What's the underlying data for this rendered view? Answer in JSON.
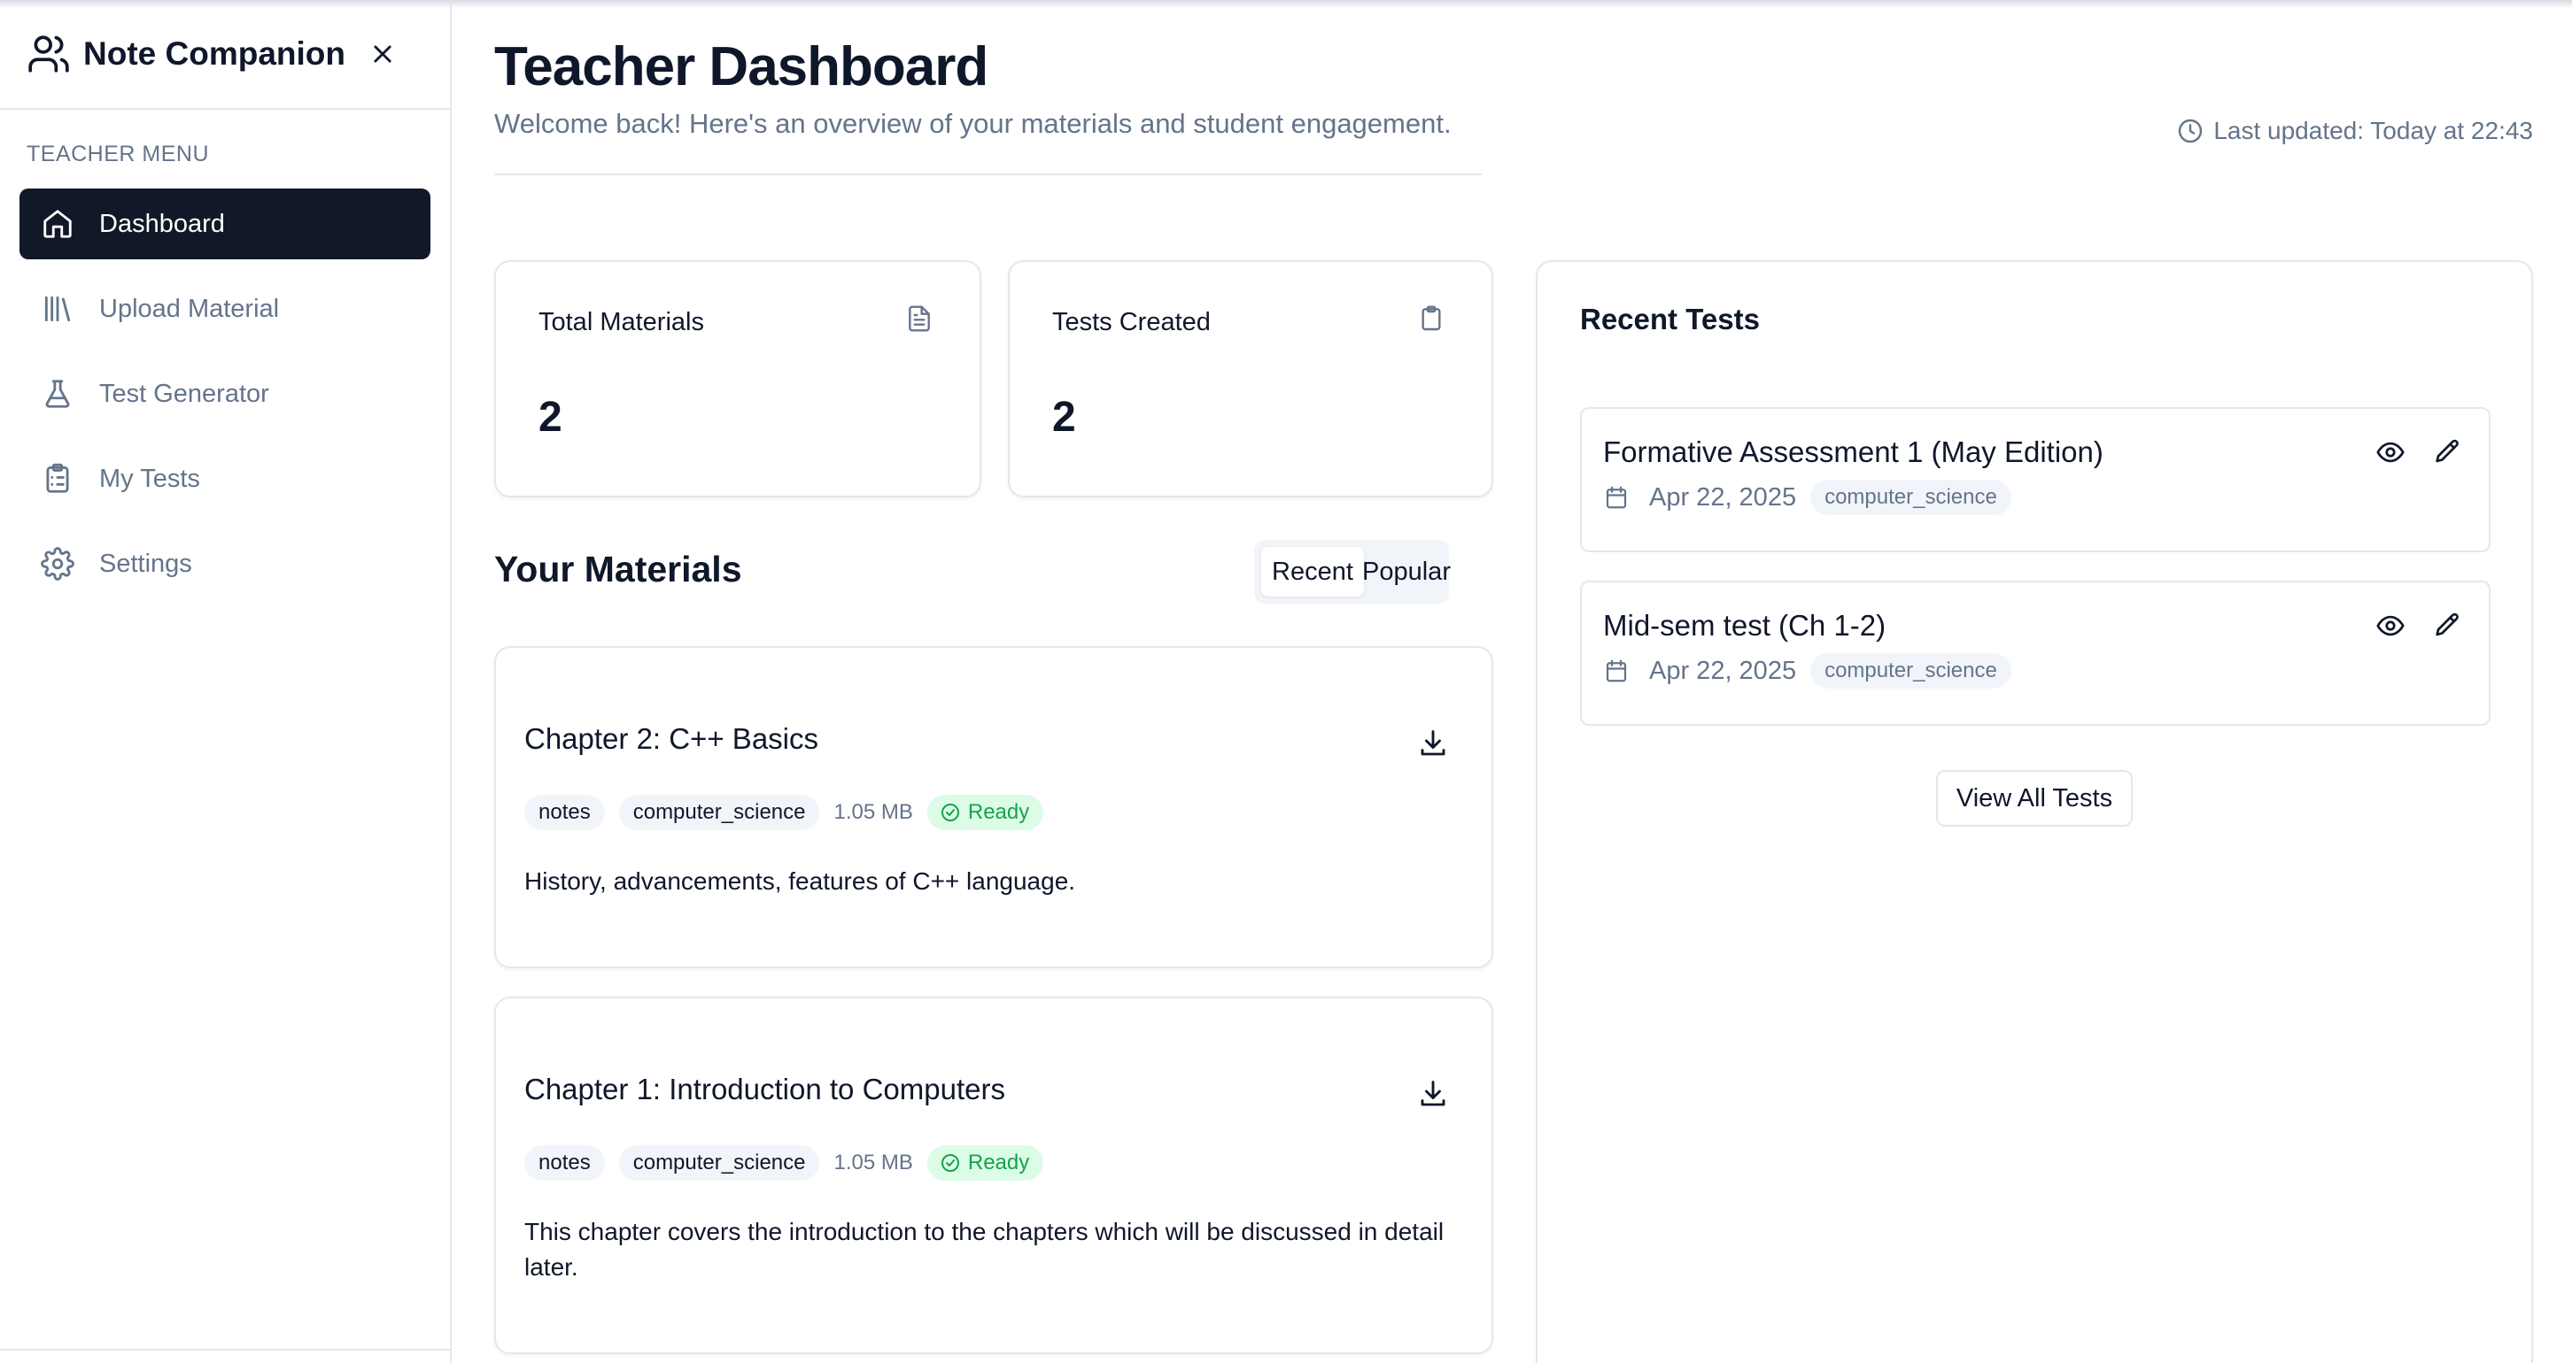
{
  "app": {
    "name": "Note Companion"
  },
  "sidebar": {
    "menu_label": "TEACHER MENU",
    "items": [
      {
        "label": "Dashboard",
        "icon": "home-icon",
        "active": true
      },
      {
        "label": "Upload Material",
        "icon": "library-icon",
        "active": false
      },
      {
        "label": "Test Generator",
        "icon": "flask-icon",
        "active": false
      },
      {
        "label": "My Tests",
        "icon": "clipboard-list-icon",
        "active": false
      },
      {
        "label": "Settings",
        "icon": "gear-icon",
        "active": false
      }
    ]
  },
  "header": {
    "title": "Teacher Dashboard",
    "subtitle": "Welcome back! Here's an overview of your materials and student engagement.",
    "last_updated": "Last updated: Today at 22:43"
  },
  "stats": [
    {
      "label": "Total Materials",
      "value": "2",
      "icon": "file-text-icon"
    },
    {
      "label": "Tests Created",
      "value": "2",
      "icon": "clipboard-icon"
    }
  ],
  "materials": {
    "title": "Your Materials",
    "tabs": [
      "Recent",
      "Popular"
    ],
    "selected_tab": "Recent",
    "items": [
      {
        "title": "Chapter 2: C++ Basics",
        "tags": [
          "notes",
          "computer_science"
        ],
        "size": "1.05 MB",
        "status": "Ready",
        "description": "History, advancements, features of C++ language."
      },
      {
        "title": "Chapter 1: Introduction to Computers",
        "tags": [
          "notes",
          "computer_science"
        ],
        "size": "1.05 MB",
        "status": "Ready",
        "description": "This chapter covers the introduction to the chapters which will be discussed in detail later."
      }
    ]
  },
  "recent_tests": {
    "title": "Recent Tests",
    "items": [
      {
        "name": "Formative Assessment 1 (May Edition)",
        "date": "Apr 22, 2025",
        "category": "computer_science"
      },
      {
        "name": "Mid-sem test (Ch 1-2)",
        "date": "Apr 22, 2025",
        "category": "computer_science"
      }
    ],
    "view_all_label": "View All Tests"
  },
  "colors": {
    "active_nav_bg": "#111827",
    "muted_text": "#64748b",
    "ready_bg": "#dcfce7",
    "ready_text": "#16a34a",
    "border": "#e5e7eb"
  }
}
